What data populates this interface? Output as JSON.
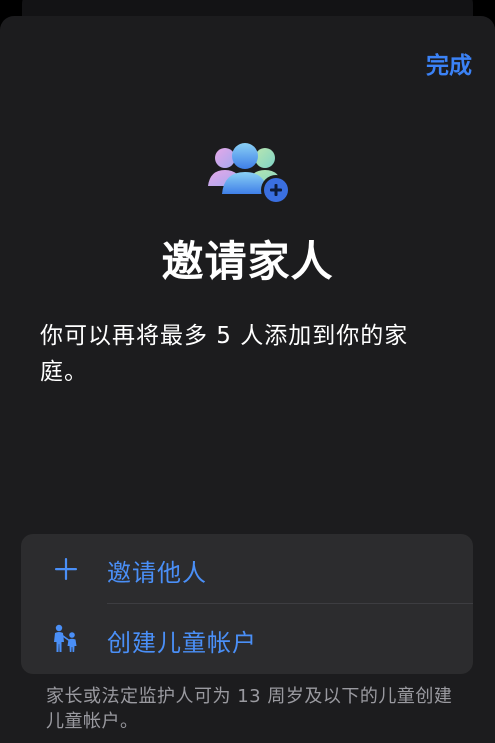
{
  "header": {
    "done_label": "完成"
  },
  "hero": {
    "icon": "family-add-icon",
    "title": "邀请家人",
    "subtitle": "你可以再将最多 5 人添加到你的家庭。"
  },
  "options": [
    {
      "icon": "plus-icon",
      "label": "邀请他人"
    },
    {
      "icon": "child-account-icon",
      "label": "创建儿童帐户"
    }
  ],
  "footnote": "家长或法定监护人可为 13 周岁及以下的儿童创建儿童帐户。",
  "colors": {
    "accent": "#3b82f6",
    "sheet_background": "#1c1c1e",
    "card_background": "#2c2c2e",
    "secondary_text": "#9a9aa0"
  }
}
